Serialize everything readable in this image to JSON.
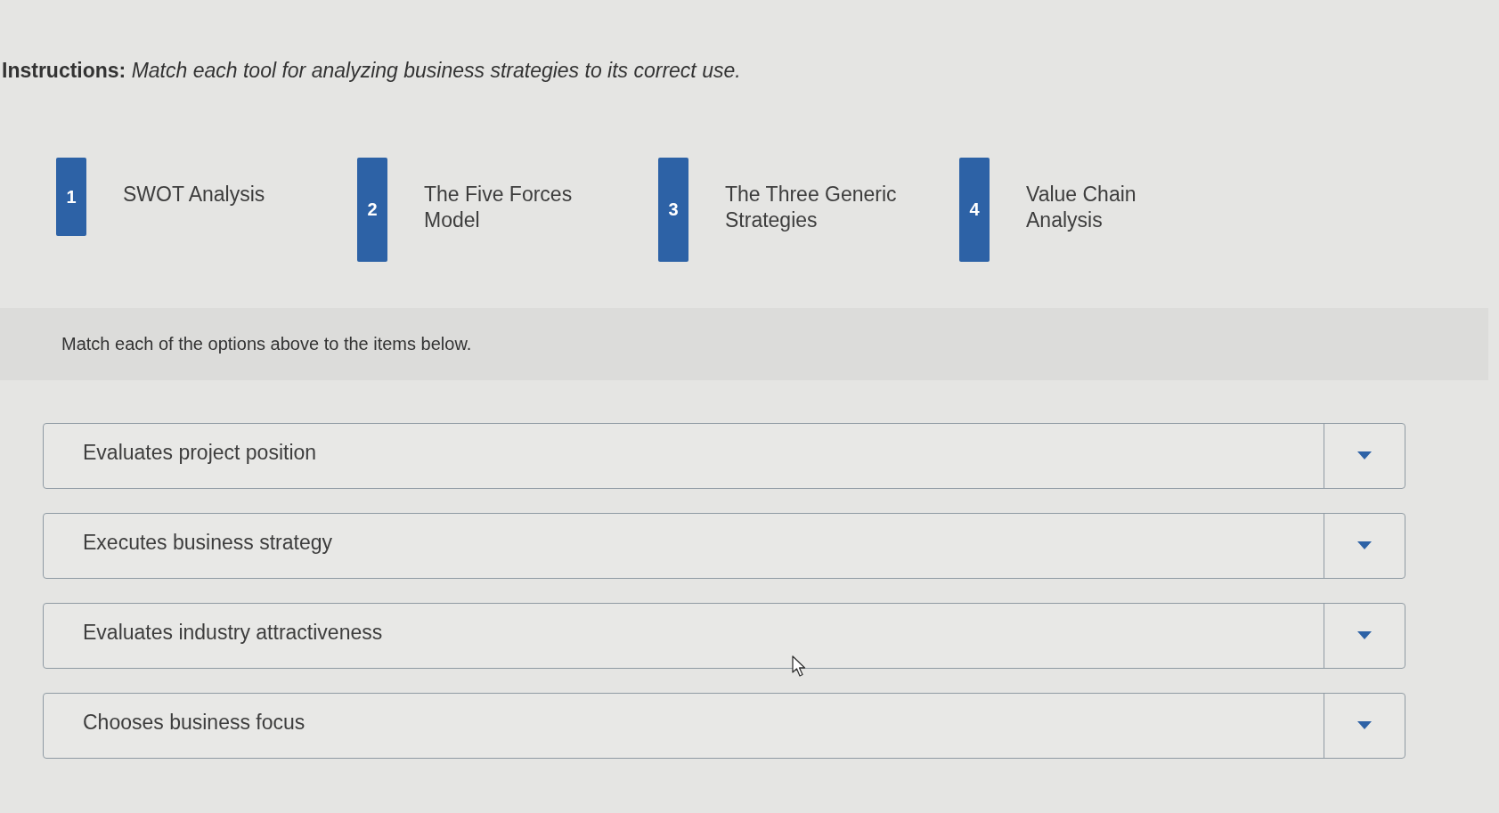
{
  "instructions": "**Instructions:** *Match each tool for analyzing business strategies to its correct use.*",
  "options": [
    {
      "number": "1",
      "label": "SWOT Analysis"
    },
    {
      "number": "2",
      "label": "The Five Forces Model"
    },
    {
      "number": "3",
      "label": "The Three Generic Strategies"
    },
    {
      "number": "4",
      "label": "Value Chain Analysis"
    }
  ],
  "prompt": "Match each of the options above to the items below.",
  "items": [
    {
      "text": "Evaluates project position"
    },
    {
      "text": "Executes business strategy"
    },
    {
      "text": "Evaluates industry attractiveness"
    },
    {
      "text": "Chooses business focus"
    }
  ]
}
